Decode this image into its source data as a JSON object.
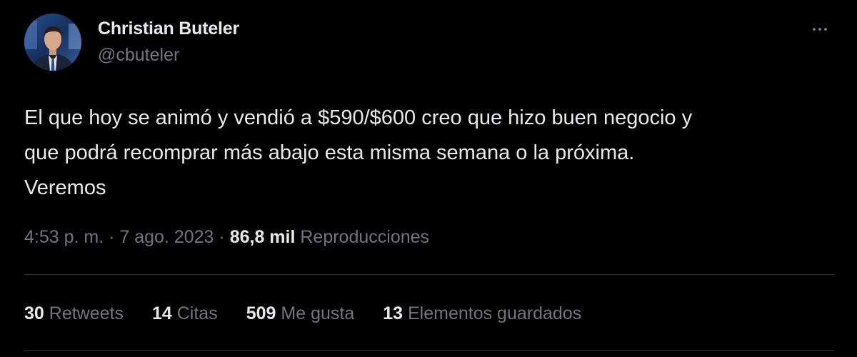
{
  "author": {
    "display_name": "Christian Buteler",
    "handle": "@cbuteler",
    "avatar_icon": "person-avatar"
  },
  "more_icon": "more-horizontal-icon",
  "tweet": {
    "text": "El que hoy se animó y vendió a $590/$600 creo que hizo buen negocio y\nque podrá recomprar más abajo esta misma semana o la próxima.\nVeremos"
  },
  "meta": {
    "time": "4:53 p. m.",
    "separator_1": " · ",
    "date": "7 ago. 2023",
    "separator_2": " · ",
    "views_count": "86,8 mil",
    "views_label": "Reproducciones"
  },
  "stats": {
    "retweets": {
      "count": "30",
      "label": "Retweets"
    },
    "quotes": {
      "count": "14",
      "label": "Citas"
    },
    "likes": {
      "count": "509",
      "label": "Me gusta"
    },
    "bookmarks": {
      "count": "13",
      "label": "Elementos guardados"
    }
  },
  "colors": {
    "background": "#000000",
    "primary_text": "#e7e9ea",
    "secondary_text": "#71767b",
    "divider": "#2f3336"
  }
}
